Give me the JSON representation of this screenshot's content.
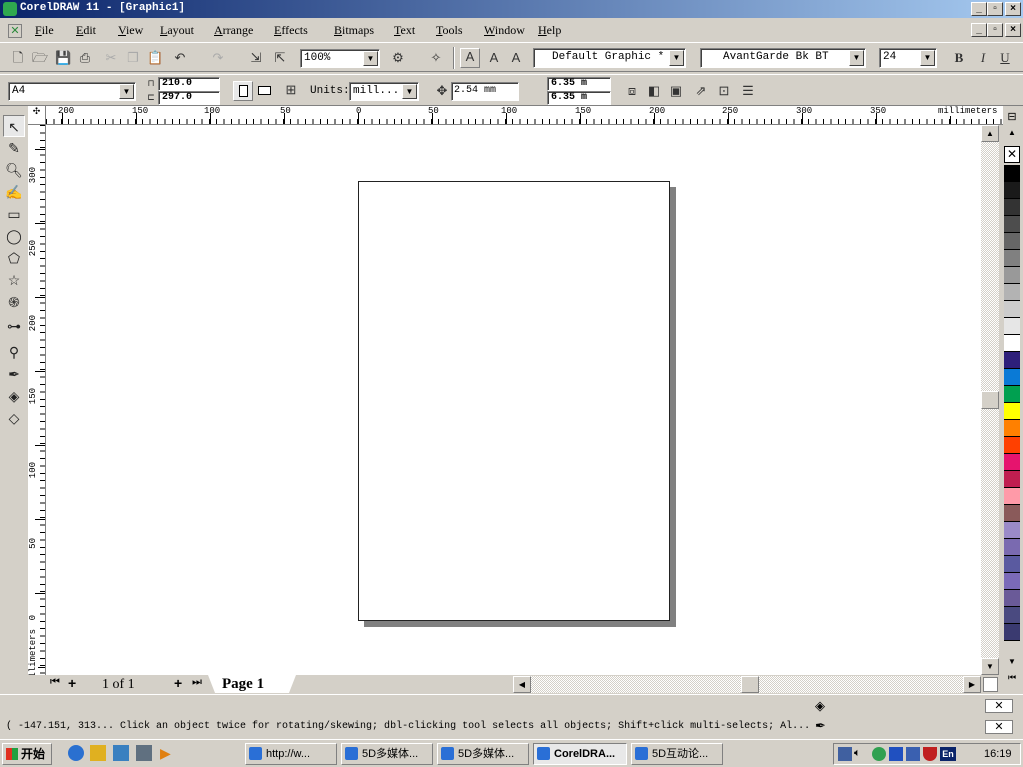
{
  "window": {
    "title": "CorelDRAW 11 - [Graphic1]"
  },
  "menu": [
    "File",
    "Edit",
    "View",
    "Layout",
    "Arrange",
    "Effects",
    "Bitmaps",
    "Text",
    "Tools",
    "Window",
    "Help"
  ],
  "standard_toolbar": {
    "zoom": "100%",
    "style": "Default Graphic *",
    "font": "AvantGarde Bk BT",
    "font_size": "24",
    "bold": "B",
    "italic": "I",
    "underline": "U"
  },
  "property_bar": {
    "paper": "A4",
    "width": "210.0",
    "height": "297.0",
    "units_label": "Units:",
    "units": "mill...",
    "nudge": "2.54 mm",
    "dup_x": "6.35 m",
    "dup_y": "6.35 m"
  },
  "ruler": {
    "h_labels": [
      "200",
      "150",
      "100",
      "50",
      "0",
      "50",
      "100",
      "150",
      "200",
      "250",
      "300",
      "350"
    ],
    "h_units": "millimeters",
    "v_labels": [
      "300",
      "250",
      "200",
      "150",
      "100",
      "50",
      "0"
    ],
    "v_units": "millimeters"
  },
  "pagebar": {
    "count": "1 of 1",
    "tab": "Page 1"
  },
  "status": {
    "text": "( -147.151, 313... Click an object twice for rotating/skewing; dbl-clicking tool selects all objects; Shift+click multi-selects; Al..."
  },
  "taskbar": {
    "start": "开始",
    "tasks": [
      "http://w...",
      "5D多媒体...",
      "5D多媒体...",
      "CorelDRA...",
      "5D互动论..."
    ],
    "lang": "En",
    "clock": "16:19"
  },
  "palette_colors": [
    "#000000",
    "#1a1a1a",
    "#333333",
    "#4d4d4d",
    "#666666",
    "#808080",
    "#999999",
    "#b3b3b3",
    "#cccccc",
    "#e6e6e6",
    "#ffffff",
    "#2e1f7a",
    "#0a7ad6",
    "#00a050",
    "#ffff00",
    "#ff8000",
    "#ff4000",
    "#e6146e",
    "#c01e50",
    "#ff9aa8",
    "#8a5a5a",
    "#9a8ac8",
    "#7a6ab0",
    "#5a5aa0",
    "#7a6ab8",
    "#6a5a98",
    "#4a4a80",
    "#3a3a70"
  ]
}
